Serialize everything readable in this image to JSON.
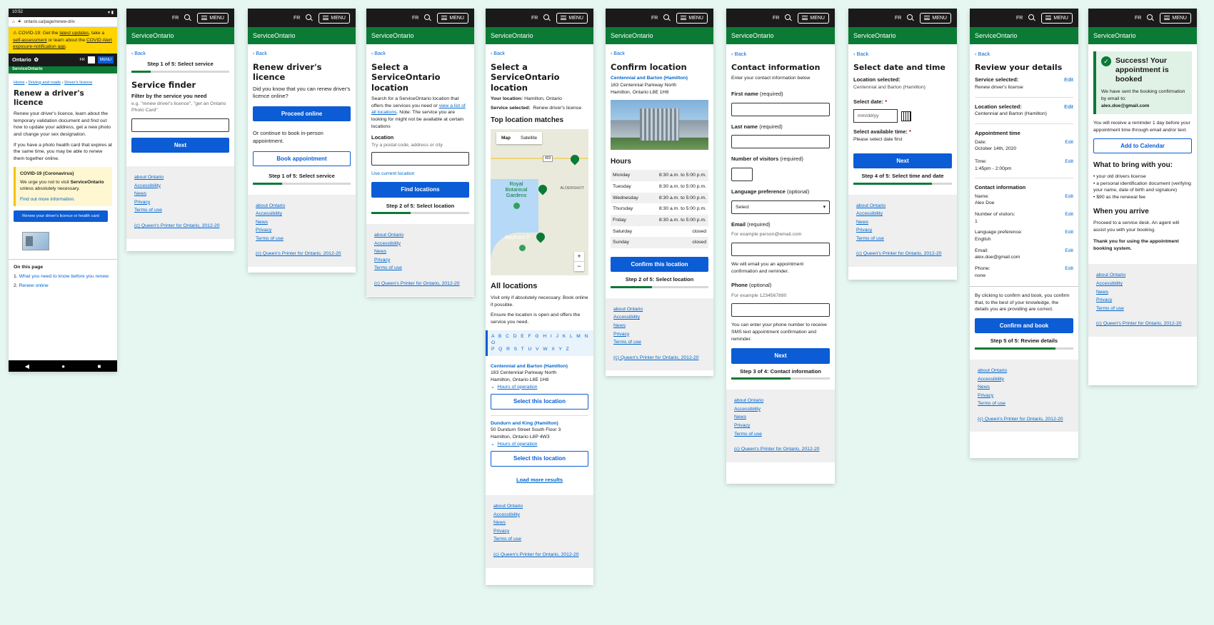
{
  "common": {
    "fr": "FR",
    "menu": "MENU",
    "brand": "ServiceOntario",
    "back": "Back",
    "footer_links": [
      "about Ontario",
      "Accessibility",
      "News",
      "Privacy",
      "Terms of use"
    ],
    "copyright": "(c) Queen's Printer for Ontario, 2012-20"
  },
  "phone": {
    "time": "10:52",
    "url": "ontario.ca/page/renew-driv",
    "alert_a": "COVID-19: Get the ",
    "alert_l1": "latest updates",
    "alert_b": ", take a ",
    "alert_l2": "self-assessment",
    "alert_c": " or learn about the ",
    "alert_l3": "COVID Alert exposure-notification app",
    "alert_d": ".",
    "ontario": "Ontario",
    "fr": "FR",
    "menu": "MENU",
    "breadcrumb": [
      "Home",
      "Driving and roads",
      "Driver's licence"
    ],
    "title": "Renew a driver's licence",
    "p1": "Renew your driver's licence, learn about the temporary validation document and find out how to update your address, get a new photo and change your sex designation.",
    "p2": "If you have a photo health card that expires at the same time, you may be able to renew them together online.",
    "covid_title": "COVID-19 (Coronavirus)",
    "covid_a": "We urge you not to visit ",
    "covid_strong": "ServiceOntario",
    "covid_b": " unless absolutely necessary.",
    "covid_link": "Find out more information.",
    "cta": "Renew your driver's licence or health card",
    "on_this_page": "On this page",
    "toc": [
      "What you need to know before you renew",
      "Renew online"
    ]
  },
  "s2": {
    "step": "Step 1 of 5: Select service",
    "title": "Service finder",
    "filter_label": "Filter by the service you need",
    "hint": "e.g. \"renew driver's licence\", \"get an Ontario Photo Card\"",
    "next": "Next"
  },
  "s3": {
    "title": "Renew driver's licence",
    "p1": "Did you know that you can renew driver's licence online?",
    "proceed": "Proceed online",
    "p2": "Or continue to book in-person appointment.",
    "book": "Book appointment",
    "step": "Step 1 of 5: Select service"
  },
  "s4": {
    "title": "Select a ServiceOntario location",
    "p_a": "Search for a ServiceOntario location that offers the services you need or ",
    "p_link": "view a list of all locations",
    "p_b": ". Note: The service you are looking for might not be available at certain locations",
    "loc_label": "Location",
    "hint": "Try a postal code, address or city",
    "use_current": "Use current location",
    "find": "Find locations",
    "step": "Step 2 of 5: Select location"
  },
  "s5": {
    "title": "Select a ServiceOntario location",
    "your_loc_label": "Your location:",
    "your_loc": "Hamilton, Ontario",
    "svc_label": "Service selected:",
    "svc": "Renew driver's license",
    "top": "Top location matches",
    "map_tab": "Map",
    "sat_tab": "Satellite",
    "map_l1": "ALDERSHOT",
    "map_l2": "Royal Botanical Gardens",
    "map_l3": "Bayfront P",
    "map_road": "403",
    "all": "All locations",
    "p1": "Visit only if absolutely necessary. Book online if possible.",
    "p2": "Ensure the location is open and offers the service you need.",
    "alpha1": "A B C D E F G H I J K L M N O",
    "alpha2": "P Q R S T U V W X Y Z",
    "loc1_name": "Centennial and Barton (Hamilton)",
    "loc1_a1": "163 Centennial Parkway North",
    "loc1_a2": "Hamilton, Ontario L8E 1H8",
    "hours_op": "Hours of operation",
    "select": "Select this location",
    "loc2_name": "Dundurn and King (Hamilton)",
    "loc2_a1": "50 Dundurn Street South Floor 3",
    "loc2_a2": "Hamilton, Ontario L8P 4W3",
    "load_more": "Load more results"
  },
  "s6": {
    "title": "Confirm location",
    "name": "Centennial and Barton (Hamilton)",
    "a1": "163 Centennial Parkway North",
    "a2": "Hamilton, Ontario L8E 1H8",
    "hours_title": "Hours",
    "hours": [
      {
        "day": "Monday",
        "time": "8:30 a.m. to 5:00 p.m."
      },
      {
        "day": "Tuesday",
        "time": "8:30 a.m. to 5:00 p.m."
      },
      {
        "day": "Wednesday",
        "time": "8:30 a.m. to 5:00 p.m."
      },
      {
        "day": "Thursday",
        "time": "8:30 a.m. to 5:00 p.m."
      },
      {
        "day": "Friday",
        "time": "8:30 a.m. to 5:00 p.m."
      },
      {
        "day": "Saturday",
        "time": "closed"
      },
      {
        "day": "Sunday",
        "time": "closed"
      }
    ],
    "confirm": "Confirm this location",
    "step": "Step 2 of 5: Select location"
  },
  "s7": {
    "title": "Contact information",
    "sub": "Enter your contact information below",
    "first": "First name",
    "last": "Last name",
    "visitors": "Number of visitors",
    "required": "(required)",
    "optional": "(optional)",
    "lang": "Language preference",
    "select": "Select",
    "email": "Email",
    "email_hint": "For example person@email.com",
    "email_note": "We will email you an appointment confirmation and reminder.",
    "phone": "Phone",
    "phone_hint": "For example 1234567890",
    "phone_note": "You can enter your phone number to receive SMS text appointment confirmation and reminder.",
    "next": "Next",
    "step": "Step 3 of 4: Contact information"
  },
  "s8": {
    "title": "Select date and time",
    "loc_label": "Location selected:",
    "loc": "Centennial and Barton (Hamilton)",
    "date_label": "Select date:",
    "star": "*",
    "date_ph": "mm/dd/yy",
    "time_label": "Select available time:",
    "time_note": "Please select date first",
    "next": "Next",
    "step": "Step 4 of 5: Select time and date"
  },
  "s9": {
    "title": "Review your details",
    "edit": "Edit",
    "svc_label": "Service selected:",
    "svc": "Renew driver's license",
    "loc_label": "Location selected:",
    "loc": "Centennial and Barton (Hamilton)",
    "appt_label": "Appointment time",
    "date_l": "Date:",
    "date": "October 14th, 2020",
    "time_l": "Time:",
    "time": "1:45pm - 2:00pm",
    "contact_label": "Contact information",
    "name_l": "Name:",
    "name": "Alex Doe",
    "vis_l": "Number of visitors:",
    "vis": "1",
    "lang_l": "Language preference:",
    "lang": "English",
    "email_l": "Email:",
    "email": "alex.doe@gmail.com",
    "phone_l": "Phone:",
    "phone": "none",
    "consent": "By clicking to confirm and book, you confirm that, to the best of your knowledge, the details you are providing are correct.",
    "confirm": "Confirm and book",
    "step": "Step 5 of 5: Review details"
  },
  "s10": {
    "title": "Success! Your appointment is booked",
    "sent": "We have sent the booking confirmation by email to:",
    "email": "alex.doe@gmail.com",
    "reminder": "You will receive a reminder 1 day before your appointment time through email and/or text.",
    "add_cal": "Add to Calendar",
    "bring_title": "What to bring with you:",
    "bring": [
      "• your old drivers license",
      "• a personal identification document (verifying your name, date of birth and signature)",
      "• $90 as the renewal fee"
    ],
    "arrive_title": "When you arrive",
    "arrive": "Proceed to a service desk. An agent will assist you with your booking.",
    "thanks": "Thank you for using the appointment booking system."
  }
}
